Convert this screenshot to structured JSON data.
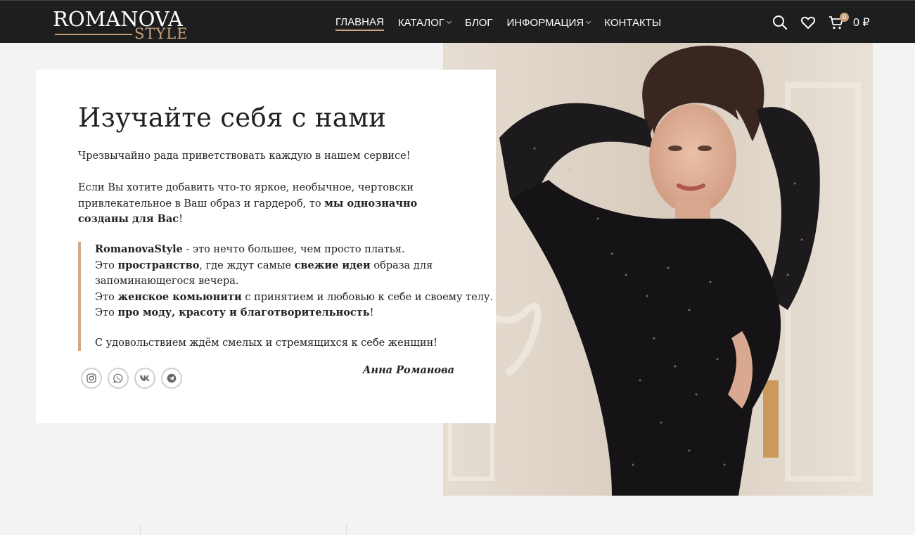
{
  "header": {
    "logo_main": "ROMANOVA",
    "logo_sub": "STYLE",
    "nav": [
      {
        "label": "ГЛАВНАЯ"
      },
      {
        "label": "КАТАЛОГ"
      },
      {
        "label": "БЛОГ"
      },
      {
        "label": "ИНФОРМАЦИЯ"
      },
      {
        "label": "КОНТАКТЫ"
      }
    ],
    "icons": [
      "search-icon",
      "heart-icon",
      "cart-icon"
    ],
    "cart_count": "0",
    "cart_total": "0 ₽"
  },
  "about": {
    "title": "Изучайте себя с нами",
    "greeting": "Чрезвычайно рада приветствовать каждую в нашем сервисе!",
    "intro_text": "Если Вы хотите добавить что-то яркое, необычное, чертовски привлекательное в Ваш образ и гардероб, то ",
    "intro_bold": "мы однозначно созданы для Вас",
    "intro_end": "!",
    "quote": {
      "l1_bold": "RomanovaStyle",
      "l1_text": " - это нечто большее, чем просто платья.",
      "l2_a": "Это ",
      "l2_b1": "пространство",
      "l2_c": ", где ждут самые ",
      "l2_b2": "свежие идеи",
      "l2_d": " образа для",
      "l3": "запоминающегося вечера.",
      "l4_a": "Это ",
      "l4_b": "женское комьюнити",
      "l4_c": " с принятием и любовью к себе и своему телу.",
      "l5_a": "Это ",
      "l5_b": "про моду, красоту и благотворительность",
      "l5_c": "!",
      "closing": "С удовольствием ждём смелых и стремящихся к себе женщин!"
    },
    "signature": "Анна Романова",
    "socials": [
      "instagram-icon",
      "whatsapp-icon",
      "vk-icon",
      "telegram-icon"
    ]
  },
  "colors": {
    "accent": "#c8a27c",
    "header_bg": "#1e1e1e",
    "page_bg": "#f3f3f3"
  }
}
